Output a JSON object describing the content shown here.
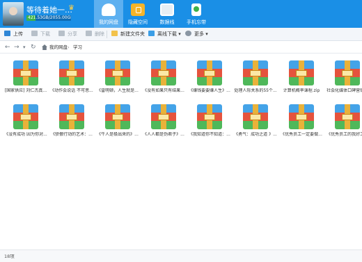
{
  "user": {
    "name": "等待着她一辈...",
    "quota_text": "421.53GB/2055.00GB",
    "quota_used_fraction": 0.205,
    "vip_icon": "crown-icon"
  },
  "nav": {
    "tabs": [
      {
        "label": "我的网盘",
        "icon": "cloud-icon",
        "active": true
      },
      {
        "label": "隐藏空间",
        "icon": "lock-icon",
        "active": false
      },
      {
        "label": "数据线",
        "icon": "monitor-icon",
        "active": false
      },
      {
        "label": "手机忘带",
        "icon": "phone-icon",
        "active": false
      }
    ]
  },
  "toolbar": {
    "upload": "上传",
    "download": "下载",
    "share": "分享",
    "delete": "删除",
    "new_folder": "新建文件夹",
    "offline_download": "离线下载",
    "more": "更多"
  },
  "address": {
    "back": "←",
    "forward": "→",
    "dropdown": "▾",
    "refresh": "↻",
    "crumb_root": "我的网盘",
    "separator": "›",
    "crumb_current": "学习"
  },
  "files": [
    {
      "name": "[国家供应] 刘仁杰真..."
    },
    {
      "name": "《动作会说话 不可思..."
    },
    {
      "name": "《雷明顿，人生就是..."
    },
    {
      "name": "《没有如果只有结果..."
    },
    {
      "name": "《赚钱要要赚人生》..."
    },
    {
      "name": "处理人际关系的55个..."
    },
    {
      "name": "计算机概率课程.zip"
    },
    {
      "name": "社会化媒体口碑营销..."
    },
    {
      "name": "《没有成功 因为你对..."
    },
    {
      "name": "《骄傲行动的艺术：..."
    },
    {
      "name": "《牛人是极出来的》..."
    },
    {
      "name": "《人人都是伪君子》..."
    },
    {
      "name": "《我知道你不知道：..."
    },
    {
      "name": "《勇气：成功之道 》..."
    },
    {
      "name": "《优秀员工一定要做..."
    },
    {
      "name": "《优秀员工的我好工..."
    }
  ],
  "status": {
    "count": "18项"
  },
  "colors": {
    "header_bg": "#1a8fe6",
    "active_tab_bg": "#5db0f0",
    "quota_fill": "#3db14a"
  }
}
